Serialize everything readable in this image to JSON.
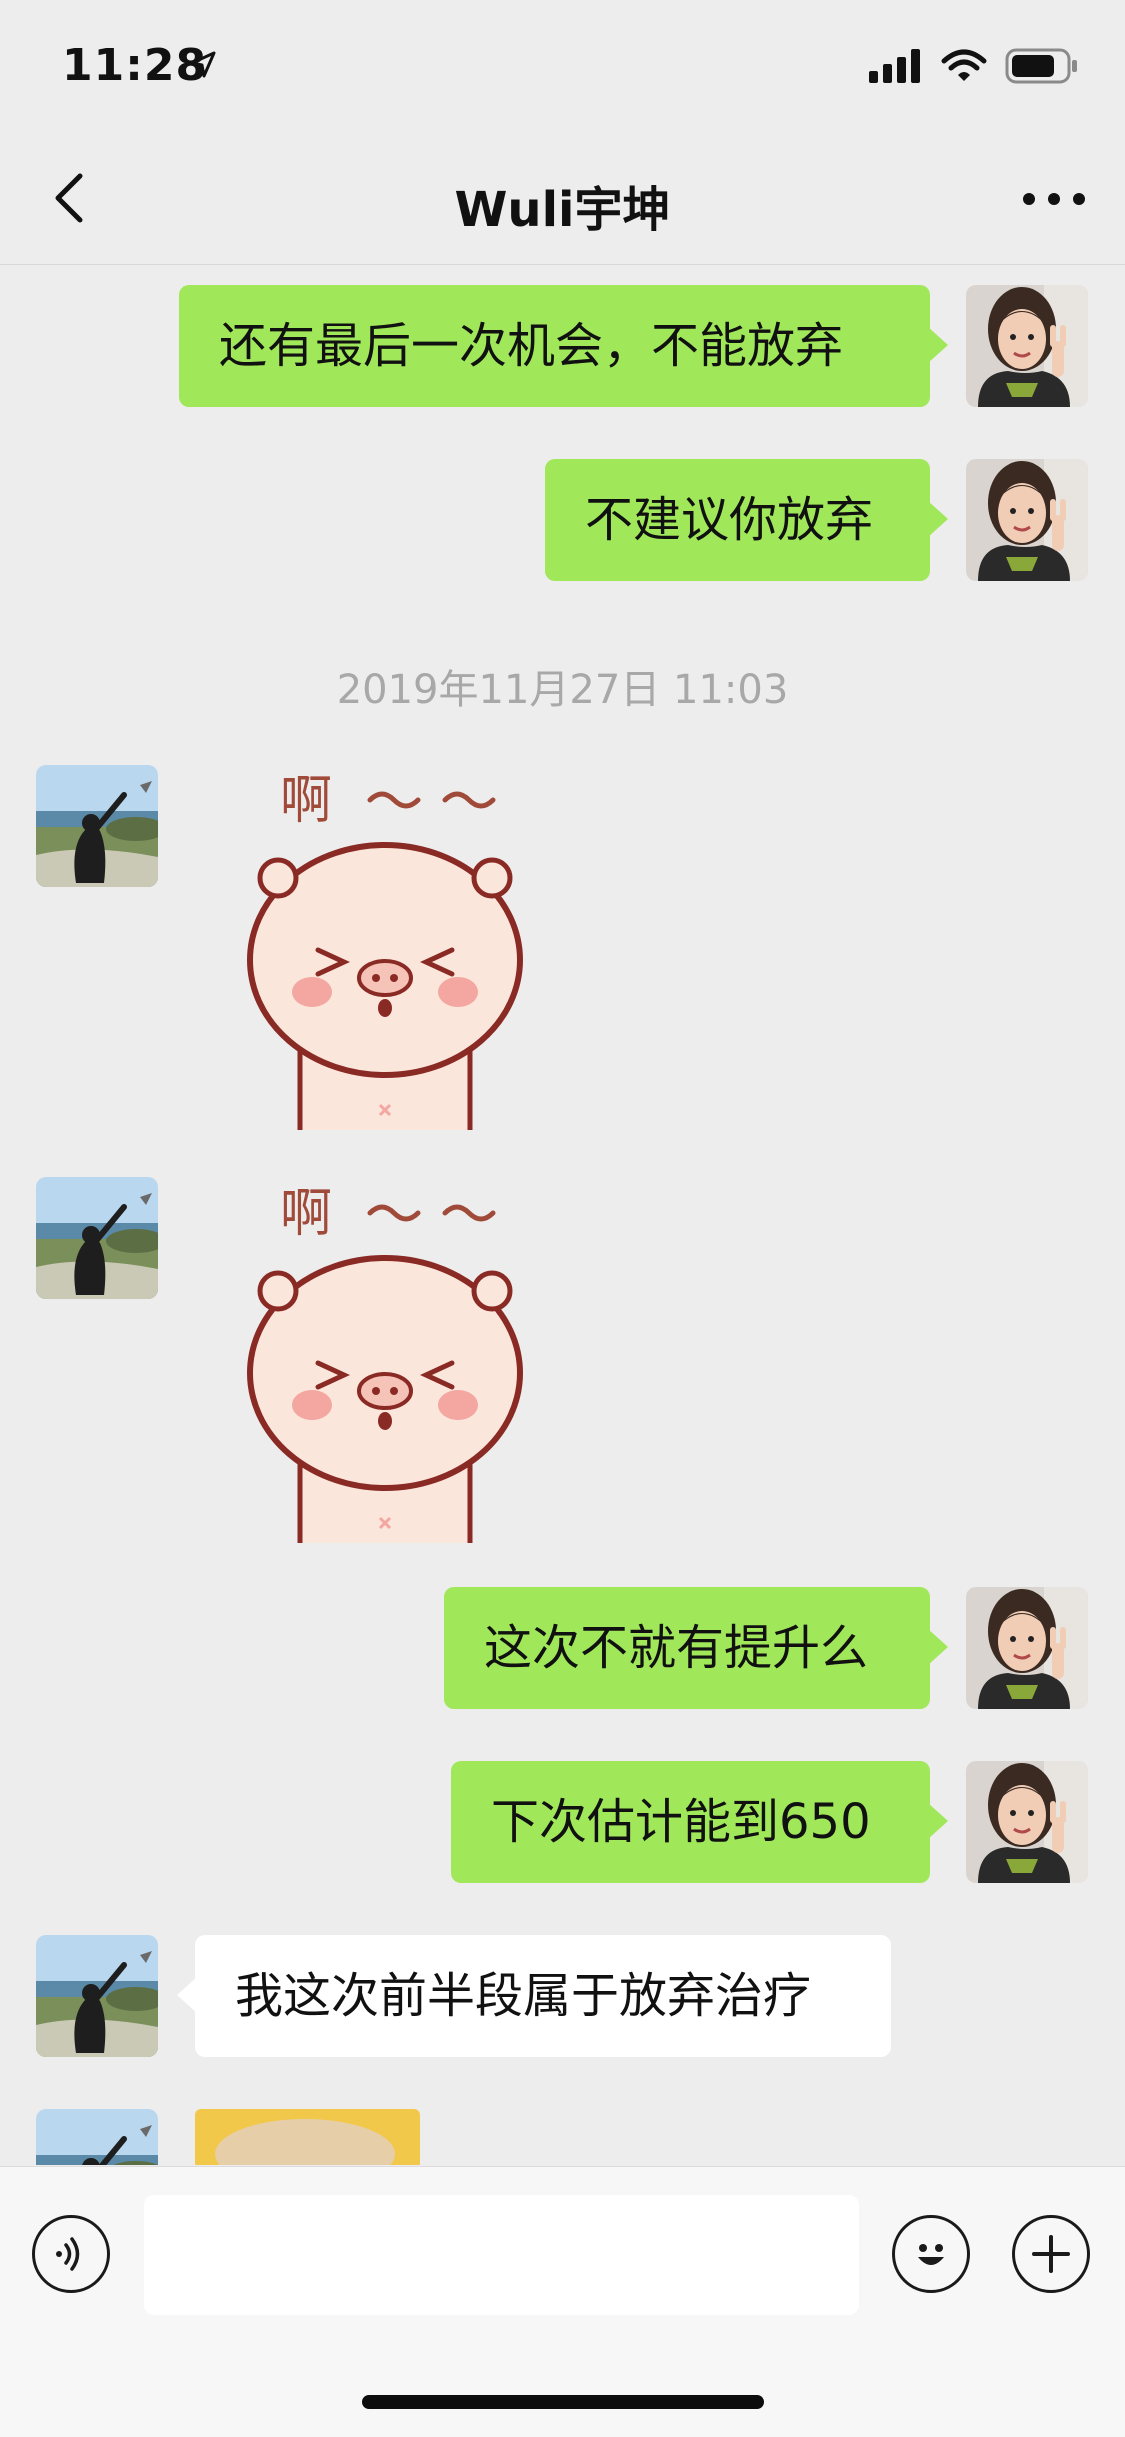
{
  "status_bar": {
    "time": "11:28"
  },
  "nav": {
    "title": "Wuli宇坤"
  },
  "timestamp": "2019年11月27日 11:03",
  "messages_top": [
    {
      "side": "me",
      "text": "还有最后一次机会，不能放弃"
    },
    {
      "side": "me",
      "text": "不建议你放弃"
    }
  ],
  "sticker_text": "啊～～",
  "messages_bottom": [
    {
      "side": "me",
      "text": "这次不就有提升么"
    },
    {
      "side": "me",
      "text": "下次估计能到650"
    },
    {
      "side": "other",
      "text": "我这次前半段属于放弃治疗"
    }
  ],
  "input": {
    "value": ""
  },
  "colors": {
    "my_bubble": "#a0e75a",
    "other_bubble": "#ffffff",
    "background": "#ededed"
  }
}
